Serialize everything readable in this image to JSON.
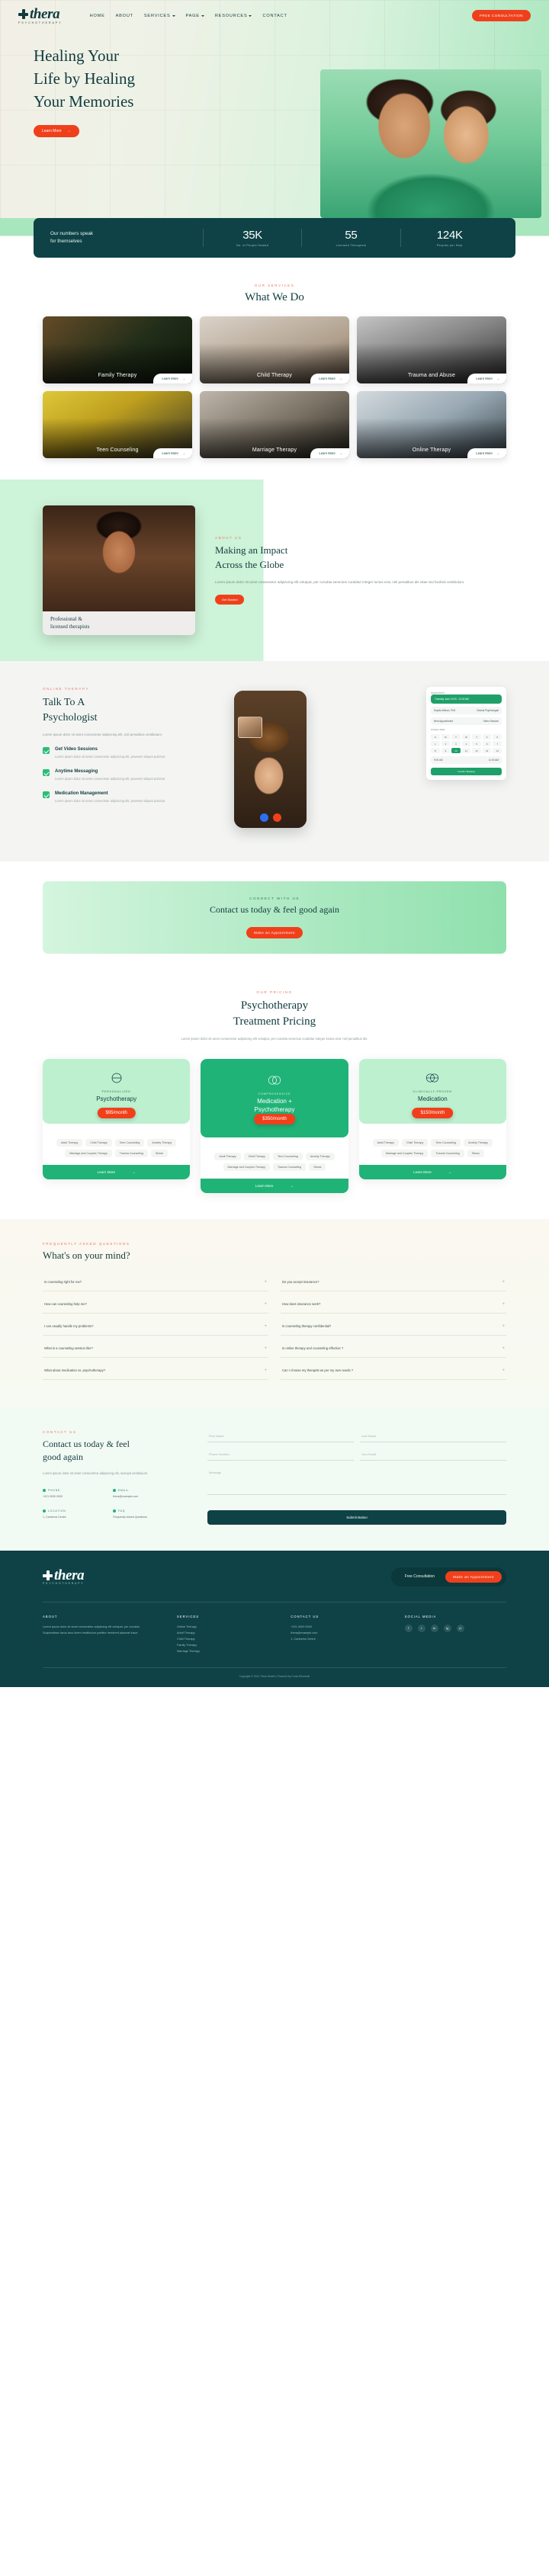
{
  "brand": {
    "name": "thera",
    "tagline": "PSYCHOTHERAPY"
  },
  "nav": {
    "items": [
      {
        "label": "HOME",
        "caret": false
      },
      {
        "label": "ABOUT",
        "caret": false
      },
      {
        "label": "SERVICES",
        "caret": true
      },
      {
        "label": "PAGE",
        "caret": true
      },
      {
        "label": "RESOURCES",
        "caret": true
      },
      {
        "label": "CONTACT",
        "caret": false
      }
    ],
    "cta": "FREE CONSULTATION"
  },
  "hero": {
    "title_l1": "Healing Your",
    "title_l2": "Life by Healing",
    "title_l3": "Your Memories",
    "cta": "Learn More",
    "arrow": "→"
  },
  "stats": {
    "lead_l1": "Our numbers speak",
    "lead_l2": "for themselves",
    "items": [
      {
        "num": "35K",
        "label": "No. of People Healed"
      },
      {
        "num": "55",
        "label": "Licensed Therapists"
      },
      {
        "num": "124K",
        "label": "Peoples per Help"
      }
    ]
  },
  "services": {
    "eyebrow": "OUR SERVICES",
    "title": "What We Do",
    "learn": "Learn More",
    "arrow": "→",
    "cards": [
      {
        "title": "Family Therapy"
      },
      {
        "title": "Child Therapy"
      },
      {
        "title": "Trauma and Abuse"
      },
      {
        "title": "Teen Counseling"
      },
      {
        "title": "Marriage Therapy"
      },
      {
        "title": "Online Therapy"
      }
    ]
  },
  "about": {
    "ribbon_l1": "Professional &",
    "ribbon_l2": "licensed therapists",
    "eyebrow": "ABOUT US",
    "title_l1": "Making an Impact",
    "title_l2": "Across the Globe",
    "body": "Lorem ipsum dolor sit amet consectetur adipiscing elit volutpat, per conubia senectus curabitur integer luctus erat, nisl penatibus dis vitae nisi facilisis vestibulum.",
    "cta": "Get Started"
  },
  "online": {
    "eyebrow": "ONLINE THERAPY",
    "title_l1": "Talk To A",
    "title_l2": "Psychologist",
    "body": "Lorem ipsum dolor sit amet consectetur adipiscing elit, nisl penatibus vestibulum.",
    "features": [
      {
        "title": "Get Video Sessions",
        "text": "Lorem ipsum dolor sit amet consectetur adipiscing elit, praesent aliquet pulvinar."
      },
      {
        "title": "Anytime Messaging",
        "text": "Lorem ipsum dolor sit amet consectetur adipiscing elit, praesent aliquet pulvinar."
      },
      {
        "title": "Medication Management",
        "text": "Lorem ipsum dolor sit amet consectetur adipiscing elit, praesent aliquet pulvinar."
      }
    ],
    "widget": {
      "header": "Appointment",
      "banner": "Tuesday June\n10:00 - 11:00 AM",
      "doctor_name": "Sophia Wilson, PhD",
      "doctor_role": "Clinical Psychologist",
      "next_label": "Next Appointment",
      "next_value": "Video Session",
      "month": "October 2024",
      "days": [
        "S",
        "M",
        "T",
        "W",
        "T",
        "F",
        "S"
      ],
      "dates": [
        "1",
        "2",
        "3",
        "4",
        "5",
        "6",
        "7",
        "8",
        "9",
        "10",
        "11",
        "12",
        "13",
        "14"
      ],
      "selected_date": "10",
      "slot_a": "9:00 AM",
      "slot_b": "11:00 AM",
      "confirm": "Confirm Booking"
    }
  },
  "cta_banner": {
    "eyebrow": "CONNECT WITH US",
    "title": "Contact us today & feel good again",
    "button": "Make an Appointment"
  },
  "pricing": {
    "eyebrow": "OUR PRICING",
    "title_l1": "Psychotherapy",
    "title_l2": "Treatment Pricing",
    "sub": "Lorem ipsum dolor sit amet consectetur adipiscing elit volutpat, per conubia senectus curabitur integer luctus erat, nisl penatibus dis.",
    "learn": "Learn More",
    "arrow": "→",
    "tags": [
      "Adult Therapy",
      "Child Therapy",
      "Teen Counseling",
      "Anxiety Therapy",
      "Marriage and Couples Therapy",
      "Trauma Counseling",
      "Stress"
    ],
    "plans": [
      {
        "kicker": "PERSONALIZED",
        "name": "Psychotherapy",
        "price": "$95/month",
        "featured": false
      },
      {
        "kicker": "COMPREHENSIVE",
        "name": "Medication +\nPsychotherapy",
        "price": "$350/month",
        "featured": true
      },
      {
        "kicker": "CLINICALLY-PROVEN",
        "name": "Medication",
        "price": "$150/month",
        "featured": false
      }
    ]
  },
  "faq": {
    "eyebrow": "FREQUENTLY ASKED QUESTIONS",
    "title": "What's on your mind?",
    "items": [
      "Is counseling right for me?",
      "Do you accept insurance?",
      "How can counseling help me?",
      "How does insurance work?",
      "I can usually handle my problems?",
      "Is counseling therapy confidential?",
      "What is a counseling session like?",
      "Is online therapy and counseling effective ?",
      "What about medication vs. psychotherapy?",
      "Can I choose my therapist as per my own needs ?"
    ],
    "plus": "+"
  },
  "contact": {
    "eyebrow": "CONTACT US",
    "title_l1": "Contact us today & feel",
    "title_l2": "good again",
    "body": "Lorem ipsum dolor sit amet consectetur adipiscing elit, suscipit vestibulum.",
    "blocks": [
      {
        "title": "PHONE",
        "value": "+021 0000 0000"
      },
      {
        "title": "EMAIL",
        "value": "thera@example.com"
      },
      {
        "title": "LOCATION",
        "value": "1, Canberra Centre"
      },
      {
        "title": "FAQ",
        "value": "Frequently Asked Questions"
      }
    ],
    "form": {
      "first_name": "First Name",
      "last_name": "Last Name",
      "phone": "Phone Number",
      "email": "Your Email",
      "message": "Message",
      "submit": "Submit Button"
    }
  },
  "footer": {
    "cta_text": "Free Consultation",
    "cta_button": "Make an Appointment",
    "columns": [
      {
        "heading": "ABOUT",
        "items": [
          "Lorem ipsum dolor sit amet consectetur adipiscing elit volutpat, per conubia.",
          "Suspendisse lacus arcu lorem vestibulum porttitor hendrerit placerat fusce."
        ]
      },
      {
        "heading": "SERVICES",
        "items": [
          "Online Therapy",
          "Adult Therapy",
          "Child Therapy",
          "Family Therapy",
          "Marriage Therapy"
        ]
      },
      {
        "heading": "CONTACT US",
        "items": [
          "+021 0000 0000",
          "thera@example.com",
          "1, Canberra Centre"
        ]
      },
      {
        "heading": "SOCIAL MEDIA",
        "items": []
      }
    ],
    "socials": [
      "f",
      "t",
      "in",
      "ig",
      "yt"
    ],
    "copyright": "Copyright © 2024 Thera Health | Powered by Cross Elements"
  }
}
